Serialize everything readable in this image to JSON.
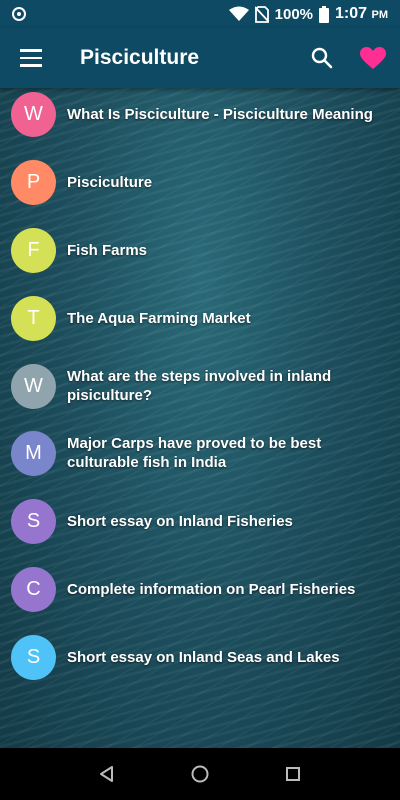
{
  "status_bar": {
    "battery": "100%",
    "time": "1:07",
    "ampm": "PM"
  },
  "app_bar": {
    "title": "Pisciculture",
    "icons": [
      "menu-icon",
      "search-icon",
      "heart-icon"
    ],
    "heart_color": "#ff2e93"
  },
  "articles": [
    {
      "letter": "W",
      "title": "What Is Pisciculture - Pisciculture Meaning",
      "color": "#f06292"
    },
    {
      "letter": "P",
      "title": "Pisciculture",
      "color": "#ff8a65"
    },
    {
      "letter": "F",
      "title": "Fish Farms",
      "color": "#d4e157"
    },
    {
      "letter": "T",
      "title": "The Aqua Farming Market",
      "color": "#d4e157"
    },
    {
      "letter": "W",
      "title": "What are the steps involved in inland pisiculture?",
      "color": "#90a4ae"
    },
    {
      "letter": "M",
      "title": "Major Carps have proved to be best culturable fish in India",
      "color": "#7986cb"
    },
    {
      "letter": "S",
      "title": "Short essay on Inland Fisheries",
      "color": "#9575cd"
    },
    {
      "letter": "C",
      "title": "Complete information on Pearl Fisheries",
      "color": "#9575cd"
    },
    {
      "letter": "S",
      "title": "Short essay on Inland Seas and Lakes",
      "color": "#4fc3f7"
    }
  ],
  "nav_bar": {
    "icons": [
      "back-icon",
      "home-icon",
      "recents-icon"
    ]
  }
}
